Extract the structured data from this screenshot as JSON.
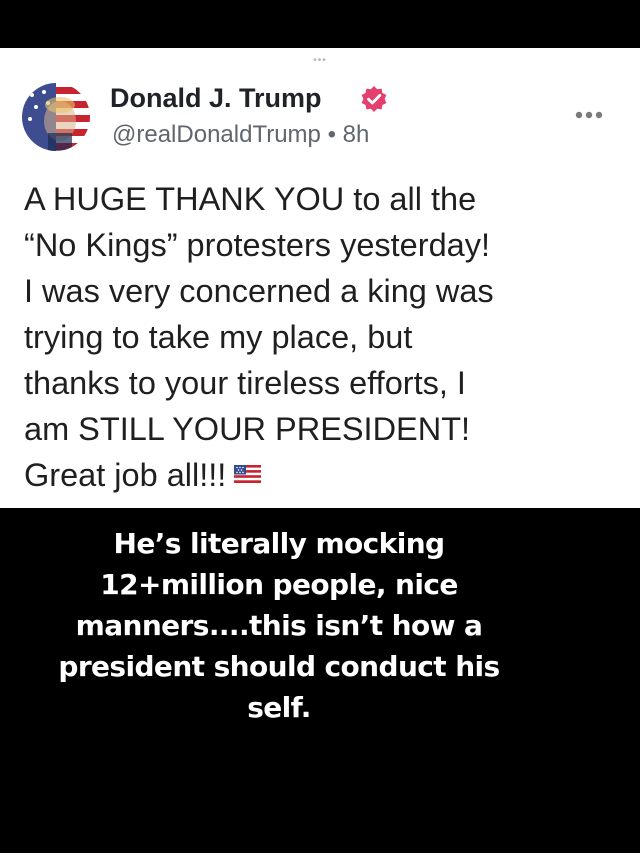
{
  "post": {
    "author_name": "Donald J. Trump",
    "handle": "@realDonaldTrump",
    "separator": "•",
    "time": "8h",
    "body_lines": [
      "A HUGE THANK YOU to all the",
      "“No Kings” protesters yesterday!",
      "I was very concerned a king was",
      "trying to take my place, but",
      "thanks to your tireless efforts, I",
      "am STILL YOUR PRESIDENT!",
      "Great job all!!!"
    ],
    "trailing_emoji": "us-flag-emoji",
    "icons": {
      "avatar": "avatar-image",
      "verified": "verified-badge-icon",
      "more": "more-options-icon",
      "top": "drag-handle-dots-icon"
    },
    "colors": {
      "verified_badge": "#e4406f",
      "name_text": "#1f2328",
      "handle_text": "#5f6670"
    }
  },
  "caption": {
    "lines": [
      "He’s literally mocking",
      "12+million people, nice",
      "manners....this isn’t how a",
      "president should conduct his",
      "self."
    ]
  },
  "colors": {
    "background": "#000000",
    "card_background": "#ffffff",
    "caption_text": "#ffffff"
  }
}
